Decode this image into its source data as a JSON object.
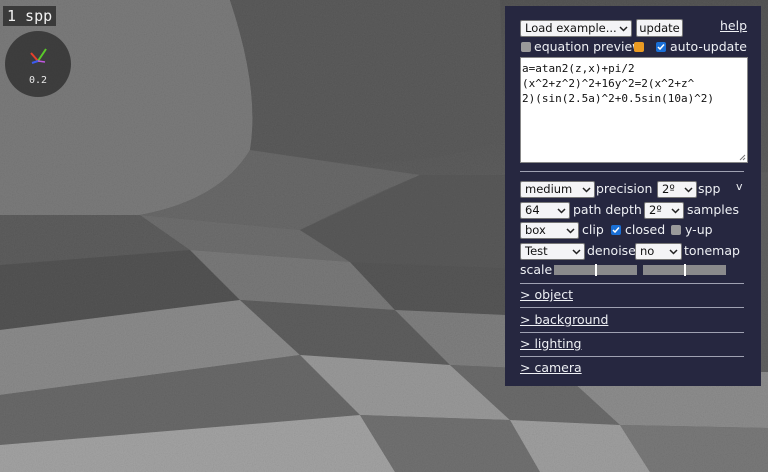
{
  "hud": {
    "spp_readout": "1 spp",
    "gizmo_scale": "0.2"
  },
  "panel": {
    "example_select": "Load example...",
    "update_button": "update",
    "help_link": "help",
    "equation_preview_label": "equation preview",
    "equation_preview_checked": false,
    "auto_update_label": "auto-update",
    "auto_update_checked": true,
    "equation_lines": [
      "a=atan2(z,x)+pi/2",
      "(x^2+z^2)^2+16y^2=2(x^2+z^",
      "2)(sin(2.5a)^2+0.5sin(10a)^2)"
    ],
    "settings": {
      "precision_select": "medium",
      "precision_label": "precision",
      "spp_select": "2º",
      "spp_label": "spp",
      "version_label": "v",
      "path_depth_select": "64",
      "path_depth_label": "path depth",
      "samples_select": "2º",
      "samples_label": "samples",
      "clip_select": "box",
      "clip_label": "clip",
      "closed_label": "closed",
      "closed_checked": true,
      "y_up_label": "y-up",
      "y_up_checked": false,
      "denoise_select": "Test",
      "denoise_label": "denoise",
      "tonemap_select": "no",
      "tonemap_label": "tonemap",
      "scale_label": "scale",
      "scale_slider_1": 0.5,
      "scale_slider_2": 0.5
    },
    "sections": [
      "> object",
      "> background",
      "> lighting",
      "> camera"
    ]
  },
  "colors": {
    "panel_bg": "#262740",
    "accent_blue": "#1a6fd6",
    "accent_orange": "#e99a22"
  },
  "icons": [
    "chevron-down-icon",
    "checkmark-icon",
    "resize-grip-icon",
    "axis-x-icon",
    "axis-y-icon",
    "axis-z-icon"
  ]
}
